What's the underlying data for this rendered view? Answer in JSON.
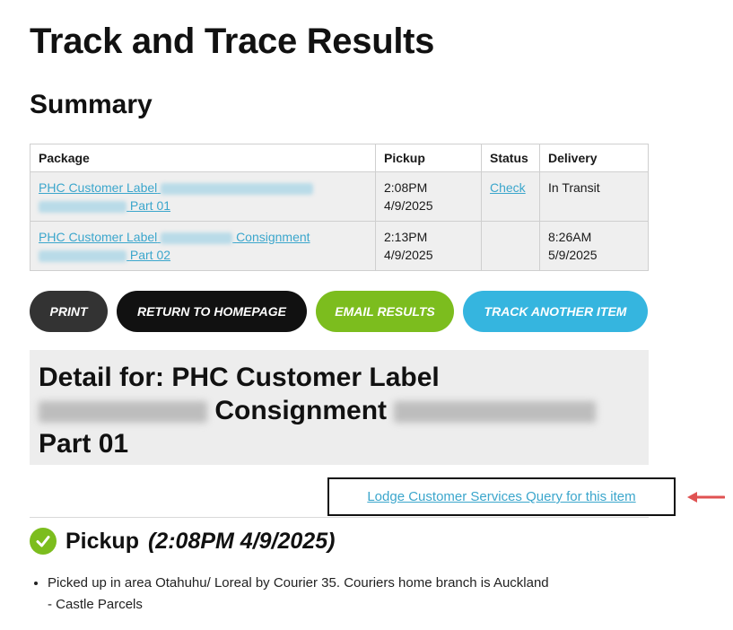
{
  "page": {
    "title": "Track and Trace Results",
    "summary_title": "Summary"
  },
  "summary_table": {
    "headers": [
      "Package",
      "Pickup",
      "Status",
      "Delivery"
    ],
    "rows": [
      {
        "package_prefix": "PHC Customer Label",
        "package_middle": "",
        "package_suffix": "Part 01",
        "pickup_time": "2:08PM",
        "pickup_date": "4/9/2025",
        "status": "Check",
        "delivery_line1": "In Transit",
        "delivery_line2": ""
      },
      {
        "package_prefix": "PHC Customer Label",
        "package_middle": "Consignment",
        "package_suffix": "Part 02",
        "pickup_time": "2:13PM",
        "pickup_date": "4/9/2025",
        "status": "",
        "delivery_line1": "8:26AM",
        "delivery_line2": "5/9/2025"
      }
    ]
  },
  "buttons": {
    "print": "PRINT",
    "home": "RETURN TO HOMEPAGE",
    "email": "EMAIL RESULTS",
    "track": "TRACK ANOTHER ITEM"
  },
  "detail": {
    "prefix": "Detail for: PHC Customer Label",
    "consignment": "Consignment",
    "part": "Part 01"
  },
  "lodge_link": "Lodge Customer Services Query for this item",
  "pickup": {
    "label": "Pickup",
    "time": "(2:08PM 4/9/2025)",
    "events": [
      "Picked up in area Otahuhu/ Loreal by Courier 35. Couriers home branch is Auckland - Castle Parcels"
    ]
  },
  "colors": {
    "link": "#3ba6cc",
    "green": "#7cbd1e",
    "blue": "#35b5df",
    "annotation_arrow": "#e05252"
  },
  "icons": [
    "check-circle-icon",
    "arrow-left-icon"
  ]
}
